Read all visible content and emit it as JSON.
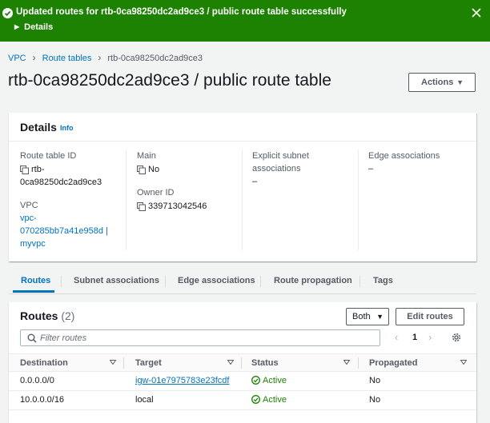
{
  "flash": {
    "message": "Updated routes for rtb-0ca98250dc2ad9ce3 / public route table successfully",
    "details_label": "Details",
    "color": "#1d8102"
  },
  "breadcrumb": {
    "items": [
      "VPC",
      "Route tables"
    ],
    "current": "rtb-0ca98250dc2ad9ce3"
  },
  "page": {
    "title": "rtb-0ca98250dc2ad9ce3 / public route table",
    "actions_label": "Actions"
  },
  "details": {
    "title": "Details",
    "info_label": "Info",
    "route_table_id": {
      "label": "Route table ID",
      "value_line1": "rtb-",
      "value_line2": "0ca98250dc2ad9ce3"
    },
    "vpc": {
      "label": "VPC",
      "line1": "vpc-",
      "line2": "070285bb7a41e958d |",
      "line3": "myvpc"
    },
    "main": {
      "label": "Main",
      "value": "No"
    },
    "owner_id": {
      "label": "Owner ID",
      "value": "339713042546"
    },
    "explicit_subnet": {
      "label_line1": "Explicit subnet",
      "label_line2": "associations",
      "value": "–"
    },
    "edge_associations": {
      "label": "Edge associations",
      "value": "–"
    }
  },
  "tabs": [
    {
      "label": "Routes",
      "active": true
    },
    {
      "label": "Subnet associations",
      "active": false
    },
    {
      "label": "Edge associations",
      "active": false
    },
    {
      "label": "Route propagation",
      "active": false
    },
    {
      "label": "Tags",
      "active": false
    }
  ],
  "routes": {
    "title": "Routes",
    "count": "(2)",
    "filter_select": "Both",
    "edit_label": "Edit routes",
    "filter_placeholder": "Filter routes",
    "page_number": "1",
    "columns": [
      "Destination",
      "Target",
      "Status",
      "Propagated"
    ],
    "rows": [
      {
        "destination": "0.0.0.0/0",
        "target": "igw-01e7975783e23fcdf",
        "status": "Active",
        "propagated": "No"
      },
      {
        "destination": "10.0.0.0/16",
        "target": "local",
        "status": "Active",
        "propagated": "No"
      }
    ]
  },
  "colors": {
    "link": "#0073bb",
    "success": "#1d8102"
  }
}
